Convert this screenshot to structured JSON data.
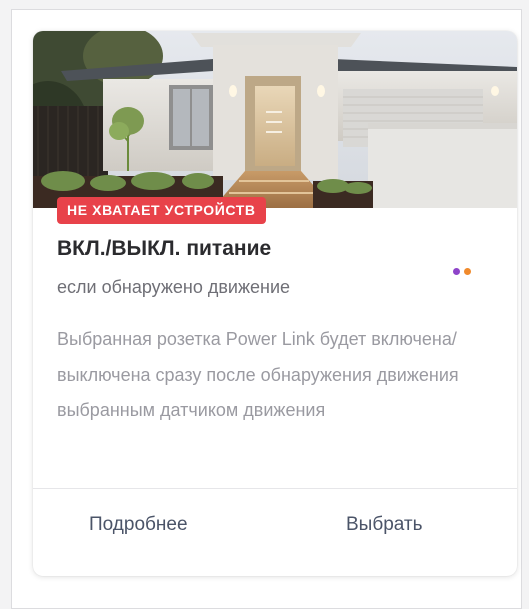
{
  "card": {
    "badge": "НЕ ХВАТАЕТ УСТРОЙСТВ",
    "title": "ВКЛ./ВЫКЛ. питание",
    "subtitle": "если обнаружено движение",
    "description": "Выбранная розетка Power Link будет включена/выключена сразу после обнаружения движения выбранным датчиком движения",
    "indicator_colors": [
      "#8e44c9",
      "#f08a2c"
    ],
    "buttons": {
      "more_label": "Подробнее",
      "select_label": "Выбрать"
    }
  },
  "colors": {
    "badge_bg": "#e8424a",
    "button_text": "#4b5468"
  }
}
